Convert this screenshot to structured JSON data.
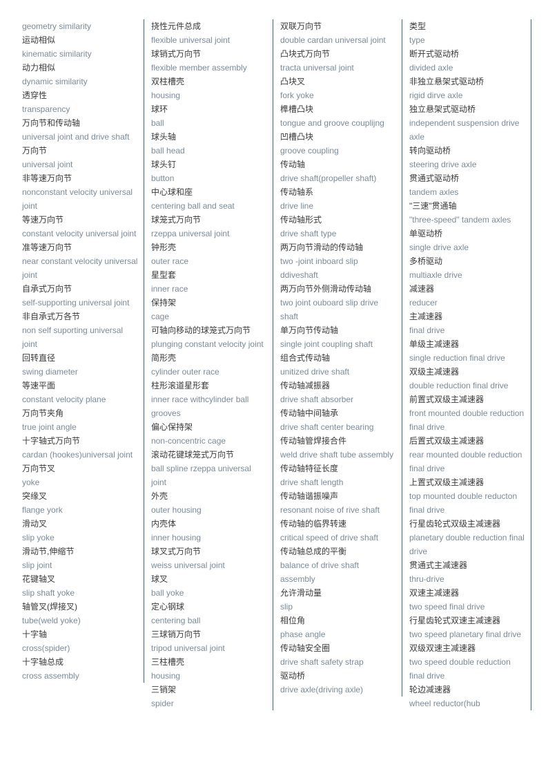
{
  "page": {
    "title": "Automotive Terminology Glossary",
    "layout": "four-column bilingual term list",
    "colors": {
      "chinese_text": "#3a3a3a",
      "english_text": "#7a8a99",
      "column_divider": "#36618e",
      "background": "#ffffff"
    }
  },
  "columns": [
    {
      "id": "column-1",
      "entries": [
        {
          "en": "geometry similarity"
        },
        {
          "cn": "运动相似",
          "en": "kinematic similarity"
        },
        {
          "cn": "动力相似",
          "en": "dynamic similarity"
        },
        {
          "cn": "透穿性",
          "en": "transparency"
        },
        {
          "cn": "万向节和传动轴",
          "en": "universal joint and drive shaft"
        },
        {
          "cn": "万向节",
          "en": "universal joint"
        },
        {
          "cn": "非等速万向节",
          "en": "nonconstant velocity universal joint"
        },
        {
          "cn": "等速万向节",
          "en": "constant velocity universal joint"
        },
        {
          "cn": "准等速万向节",
          "en": "near constant velocity universal joint"
        },
        {
          "cn": "自承式万向节",
          "en": "self-supporting universal joint"
        },
        {
          "cn": "非自承式万各节",
          "en": "non self suporting universal joint"
        },
        {
          "cn": "回转直径",
          "en": "swing diameter"
        },
        {
          "cn": "等速平面",
          "en": "constant velocity plane"
        },
        {
          "cn": "万向节夹角",
          "en": "true joint angle"
        },
        {
          "cn": "十字轴式万向节",
          "en": "cardan (hookes)universal joint"
        },
        {
          "cn": "万向节叉",
          "en": "yoke"
        },
        {
          "cn": "突缘叉",
          "en": "flange york"
        },
        {
          "cn": "滑动叉",
          "en": "slip yoke"
        },
        {
          "cn": "滑动节,伸缩节",
          "en": "slip joint"
        },
        {
          "cn": "花键轴叉",
          "en": "slip shaft yoke"
        },
        {
          "cn": "轴管叉(焊接叉)",
          "en": "tube(weld yoke)"
        },
        {
          "cn": "十字轴",
          "en": "cross(spider)"
        },
        {
          "cn": "十字轴总成",
          "en": "cross assembly"
        }
      ]
    },
    {
      "id": "column-2",
      "entries": [
        {
          "cn": "挠性元件总成",
          "en": "flexible universal joint"
        },
        {
          "cn": "球销式万向节",
          "en": "flexible member assembly"
        },
        {
          "cn": "双柱槽壳",
          "en": "housing"
        },
        {
          "cn": "球环",
          "en": "ball"
        },
        {
          "cn": "球头轴",
          "en": "ball head"
        },
        {
          "cn": "球头钉",
          "en": "button"
        },
        {
          "cn": "中心球和座",
          "en": "centering ball and seat"
        },
        {
          "cn": "球笼式万向节",
          "en": "rzeppa universal joint"
        },
        {
          "cn": "钟形壳",
          "en": "outer race"
        },
        {
          "cn": "星型套",
          "en": "inner race"
        },
        {
          "cn": "保持架",
          "en": "cage"
        },
        {
          "cn": "可轴向移动的球笼式万向节",
          "en": "plunging constant velocity joint"
        },
        {
          "cn": "简形壳",
          "en": "cylinder outer race"
        },
        {
          "cn": "柱形滚道星形套",
          "en": "inner race withcylinder ball grooves"
        },
        {
          "cn": "偏心保持架",
          "en": "non-concentric cage"
        },
        {
          "cn": "滚动花键球笼式万向节",
          "en": "ball spline rzeppa universal joint"
        },
        {
          "cn": "外壳",
          "en": "outer housing"
        },
        {
          "cn": "内壳体",
          "en": "inner housing"
        },
        {
          "cn": "球叉式万向节",
          "en": "weiss universal joint"
        },
        {
          "cn": "球叉",
          "en": "ball yoke"
        },
        {
          "cn": "定心钢球",
          "en": "centering ball"
        },
        {
          "cn": "三球销万向节",
          "en": "tripod universal joint"
        },
        {
          "cn": "三柱槽壳",
          "en": "housing"
        },
        {
          "cn": "三销架",
          "en": "spider"
        }
      ]
    },
    {
      "id": "column-3",
      "entries": [
        {
          "cn": "双联万向节",
          "en": "double cardan universal joint"
        },
        {
          "cn": "凸块式万向节",
          "en": "tracta universal joint"
        },
        {
          "cn": "凸块叉",
          "en": "fork yoke"
        },
        {
          "cn": "榫槽凸块",
          "en": "tongue and groove couplijng"
        },
        {
          "cn": "凹槽凸块",
          "en": "groove coupling"
        },
        {
          "cn": "传动轴",
          "en": "drive shaft(propeller shaft)"
        },
        {
          "cn": "传动轴系",
          "en": "drive line"
        },
        {
          "cn": "传动轴形式",
          "en": "drive shaft type"
        },
        {
          "cn": "两万向节滑动的传动轴",
          "en": "two -joint inboard slip ddiveshaft"
        },
        {
          "cn": "两万向节外侧滑动传动轴",
          "en": "two joint ouboard slip drive shaft"
        },
        {
          "cn": "单万向节传动轴",
          "en": "single joint coupling shaft"
        },
        {
          "cn": "组合式传动轴",
          "en": "unitized drive shaft"
        },
        {
          "cn": "传动轴减振器",
          "en": "drive shaft absorber"
        },
        {
          "cn": "传动轴中间轴承",
          "en": "drive shaft center bearing"
        },
        {
          "cn": "传动轴管焊接合件",
          "en": "weld drive shaft tube assembly"
        },
        {
          "cn": "传动轴特征长度",
          "en": "drive shaft length"
        },
        {
          "cn": "传动轴谐振噪声",
          "en": "resonant noise of rive shaft"
        },
        {
          "cn": "传动轴的临界转速",
          "en": "critical speed of drive shaft"
        },
        {
          "cn": "传动轴总成的平衡",
          "en": "balance of drive shaft assembly"
        },
        {
          "cn": "允许滑动量",
          "en": "slip"
        },
        {
          "cn": "相位角",
          "en": "phase angle"
        },
        {
          "cn": "传动轴安全圈",
          "en": "drive shaft safety strap"
        },
        {
          "cn": "驱动桥",
          "en": "drive axle(driving axle)"
        }
      ]
    },
    {
      "id": "column-4",
      "entries": [
        {
          "cn": "类型",
          "en": "type"
        },
        {
          "cn": "断开式驱动桥",
          "en": "divided axle"
        },
        {
          "cn": "非独立悬架式驱动桥",
          "en": "rigid dirve axle"
        },
        {
          "cn": "独立悬架式驱动桥",
          "en": "independent suspension drive axle"
        },
        {
          "cn": "转向驱动桥",
          "en": "steering drive axle"
        },
        {
          "cn": "贯通式驱动桥",
          "en": "tandem axles"
        },
        {
          "cn": "\"三速\"贯通轴",
          "en": "\"three-speed\" tandem axles"
        },
        {
          "cn": "单驱动桥",
          "en": "single drive axle"
        },
        {
          "cn": "多桥驱动",
          "en": "multiaxle drive"
        },
        {
          "cn": "减速器",
          "en": "reducer"
        },
        {
          "cn": "主减速器",
          "en": "final drive"
        },
        {
          "cn": "单级主减速器",
          "en": "single reduction final drive"
        },
        {
          "cn": "双级主减速器",
          "en": "double reduction final drive"
        },
        {
          "cn": "前置式双级主减速器",
          "en": "front mounted double reduction final drive"
        },
        {
          "cn": "后置式双级主减速器",
          "en": "rear mounted double reduction final drive"
        },
        {
          "cn": "上置式双级主减速器",
          "en": "top mounted double reducton final drive"
        },
        {
          "cn": "行星齿轮式双级主减速器",
          "en": "planetary double reduction final drive"
        },
        {
          "cn": "贯通式主减速器",
          "en": "thru-drive"
        },
        {
          "cn": "双速主减速器",
          "en": "two speed final drive"
        },
        {
          "cn": "行星齿轮式双速主减速器",
          "en": "two speed planetary final drive"
        },
        {
          "cn": "双级双速主减速器",
          "en": "two speed double reduction final drive"
        },
        {
          "cn": "轮边减速器",
          "en": "wheel reductor(hub"
        }
      ]
    }
  ]
}
